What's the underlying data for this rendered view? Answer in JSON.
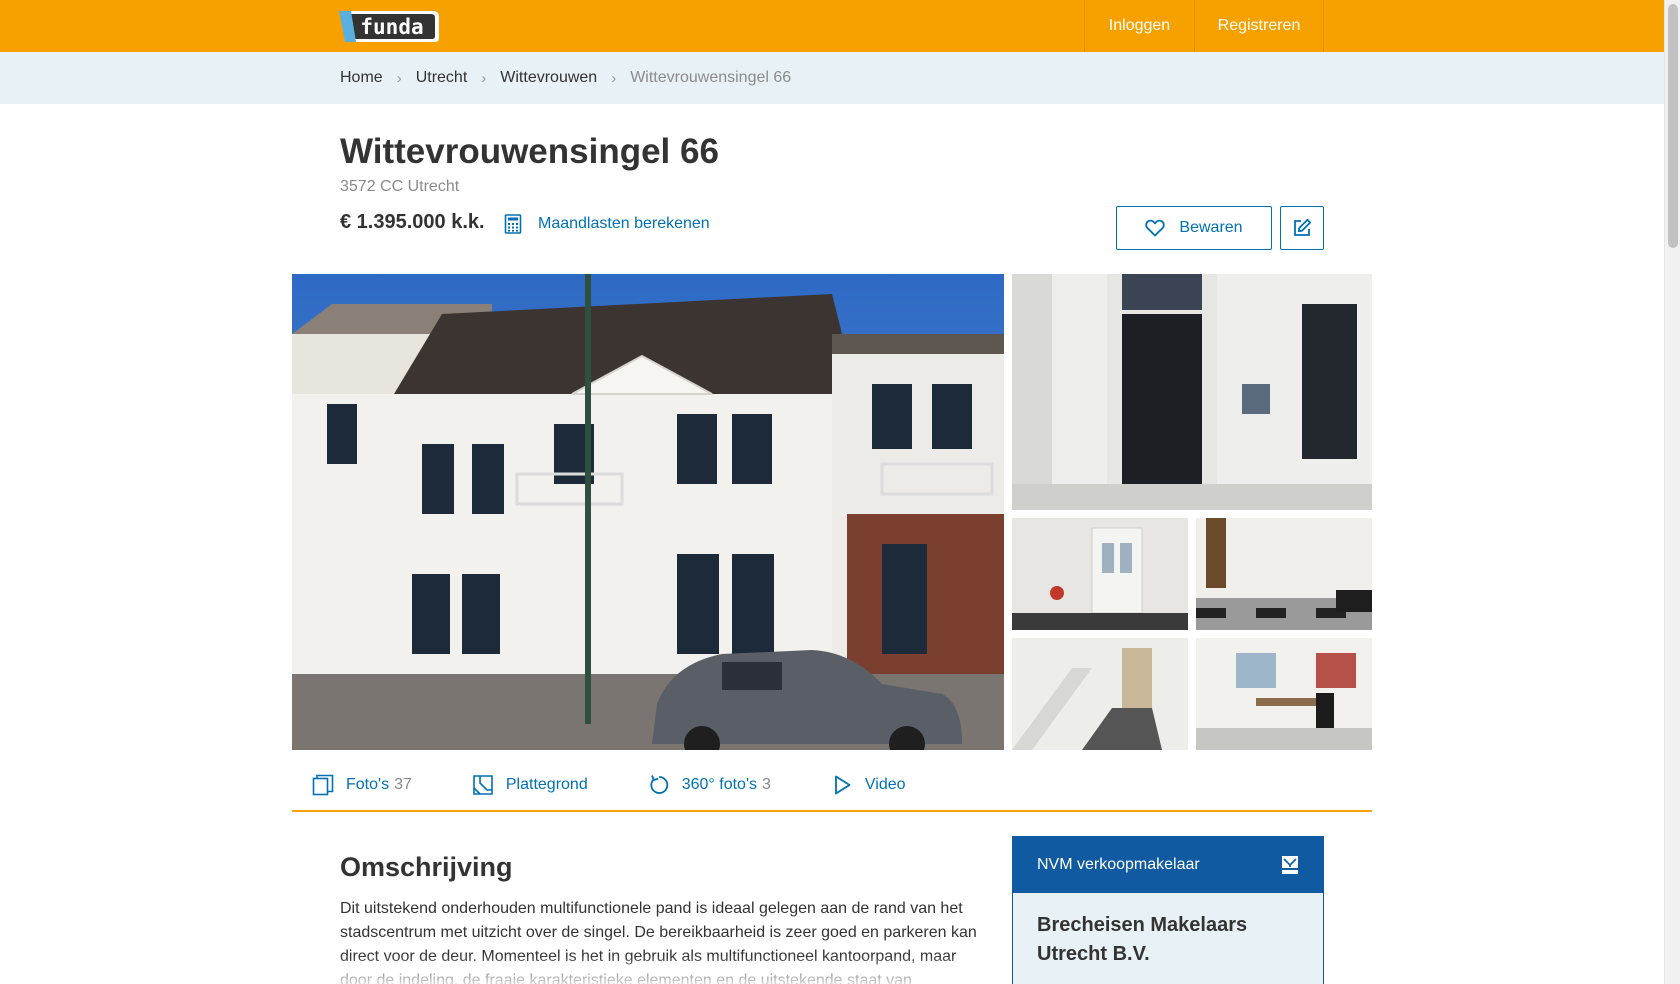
{
  "header": {
    "logo_text": "funda",
    "nav": {
      "login": "Inloggen",
      "register": "Registreren"
    },
    "brand_color": "#f7a100"
  },
  "breadcrumb": {
    "items": [
      "Home",
      "Utrecht",
      "Wittevrouwen"
    ],
    "current": "Wittevrouwensingel 66"
  },
  "listing": {
    "title": "Wittevrouwensingel 66",
    "postal": "3572 CC Utrecht",
    "price": "€ 1.395.000 k.k.",
    "calc_link": "Maandlasten berekenen",
    "save_label": "Bewaren"
  },
  "media_tabs": [
    {
      "label": "Foto's",
      "count": "37",
      "icon": "photos-icon"
    },
    {
      "label": "Plattegrond",
      "count": "",
      "icon": "floorplan-icon"
    },
    {
      "label": "360° foto's",
      "count": "3",
      "icon": "rotate-360-icon"
    },
    {
      "label": "Video",
      "count": "",
      "icon": "play-icon"
    }
  ],
  "description": {
    "heading": "Omschrijving",
    "text": "Dit uitstekend onderhouden multifunctionele pand is ideaal gelegen aan de rand van het stadscentrum met uitzicht over de singel. De bereikbaarheid is zeer goed en parkeren kan direct voor de deur. Momenteel is het in gebruik als multifunctioneel kantoorpand, maar door de indeling, de fraaie karakteristieke elementen en de uitstekende staat van onderhoud"
  },
  "agent": {
    "header": "NVM verkoopmakelaar",
    "name": "Brecheisen Makelaars Utrecht B.V."
  },
  "colors": {
    "link": "#0071b3",
    "agent_header": "#0f5aa0",
    "breadcrumb_bg": "#e8f1f6"
  }
}
